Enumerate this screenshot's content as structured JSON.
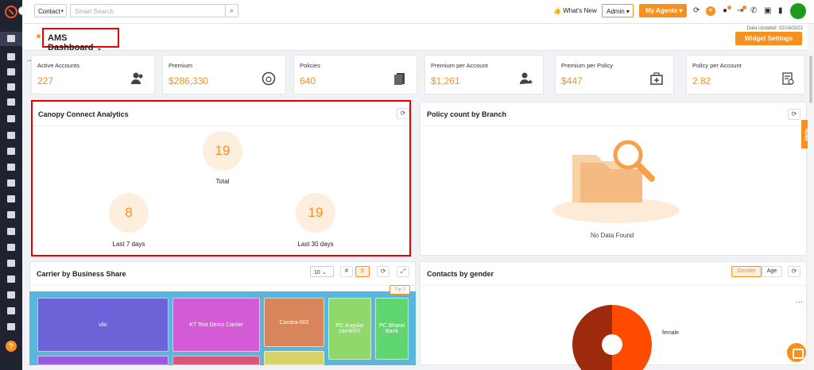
{
  "topbar": {
    "entity_select": "Contact",
    "search_placeholder": "Smart Search",
    "whats_new": "What's New",
    "admin": "Admin",
    "my_agents": "My Agents"
  },
  "header": {
    "title": "AMS Dashboard",
    "updated": "Data Updated: 02/16/2022",
    "widget_settings": "Widget Settings"
  },
  "kpis": [
    {
      "label": "Active Accounts",
      "value": "227",
      "icon": "users-icon"
    },
    {
      "label": "Premium",
      "value": "$286,330",
      "icon": "piggy-icon"
    },
    {
      "label": "Policies",
      "value": "640",
      "icon": "documents-icon"
    },
    {
      "label": "Premium per Account",
      "value": "$1,261",
      "icon": "user-star-icon"
    },
    {
      "label": "Premium per Policy",
      "value": "$447",
      "icon": "medical-bag-icon"
    },
    {
      "label": "Policy per Account",
      "value": "2.82",
      "icon": "policy-doc-icon"
    }
  ],
  "canopy": {
    "title": "Canopy Connect Analytics",
    "total": {
      "value": "19",
      "label": "Total"
    },
    "last7": {
      "value": "8",
      "label": "Last 7 days"
    },
    "last30": {
      "value": "19",
      "label": "Last 30 days"
    }
  },
  "branch": {
    "title": "Policy count by Branch",
    "empty": "No Data Found"
  },
  "carrier": {
    "title": "Carrier by Business Share",
    "page_size": "10",
    "hash": "#",
    "dollar": "$",
    "top": "Top 3",
    "tiles": [
      {
        "label": "vilo",
        "color": "#6c63d9"
      },
      {
        "label": "KT Test Demo Carrier",
        "color": "#d45bd6"
      },
      {
        "label": "Canara-002",
        "color": "#d9855c"
      },
      {
        "label": "PC Angular carrier07",
        "color": "#8fd86a"
      },
      {
        "label": "PC Bharat Bank",
        "color": "#5fd670"
      },
      {
        "label": "",
        "color": "#9a5ae0"
      },
      {
        "label": "",
        "color": "#d9557a"
      },
      {
        "label": "",
        "color": "#d6d36a"
      }
    ]
  },
  "gender": {
    "title": "Contacts by gender",
    "tab_gender": "Gender",
    "tab_age": "Age",
    "legend": "female",
    "slices": [
      {
        "name": "female",
        "value": 50,
        "color": "#fe4b00"
      },
      {
        "name": "",
        "value": 50,
        "color": "#9e2a0e"
      }
    ]
  },
  "help": "Help"
}
